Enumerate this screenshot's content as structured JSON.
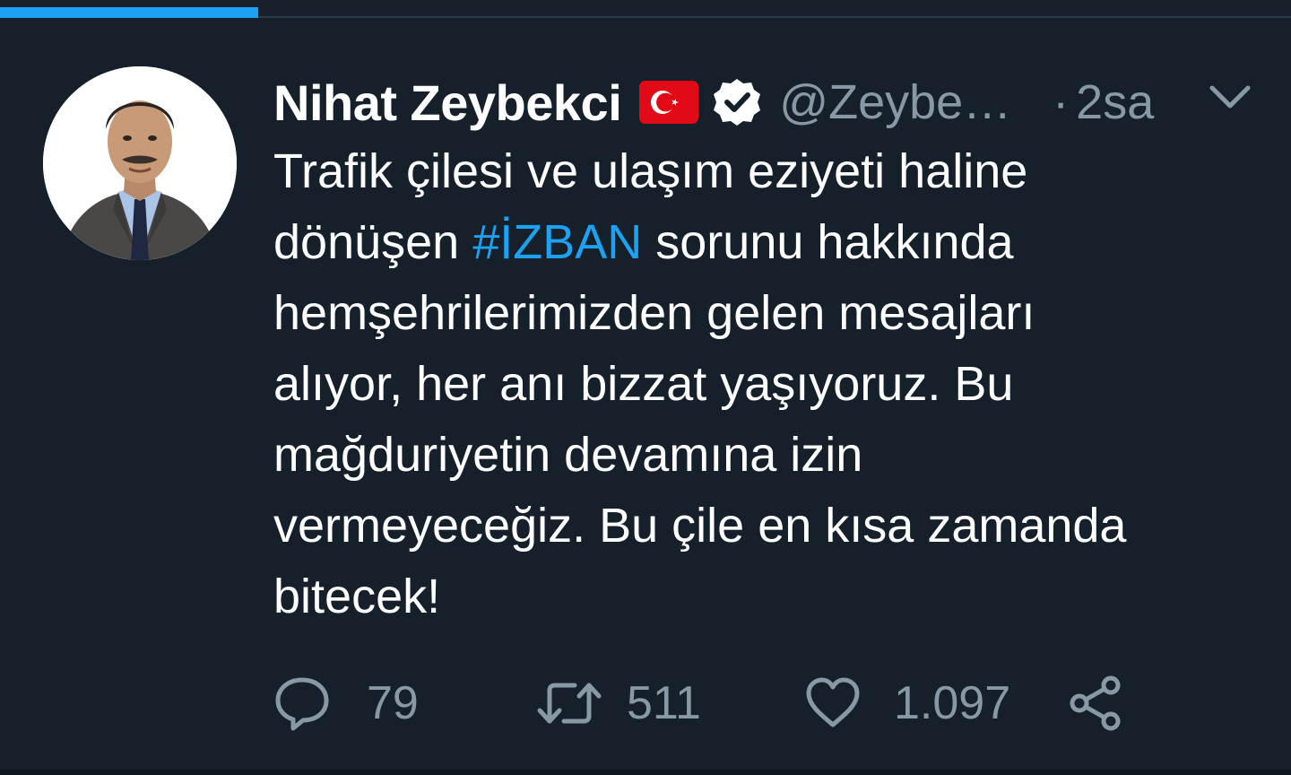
{
  "progress": {
    "value": 0.2
  },
  "tweet": {
    "author_name": "Nihat Zeybekci",
    "handle": "@Zeybe…",
    "separator": "·",
    "time": "2sa",
    "flag_icon": "turkey-flag-icon",
    "verified_icon": "verified-badge-icon",
    "menu_icon": "chevron-down-icon",
    "text_before": "Trafik çilesi ve ulaşım eziyeti haline\ndönüşen ",
    "hashtag": "#İZBAN",
    "text_after": " sorunu hakkında\nhemşehrilerimizden gelen mesajları\nalıyor, her anı bizzat yaşıyoruz. Bu\nmağduriyetin devamına izin\nvermeyeceğiz. Bu çile en kısa zamanda\nbitecek!"
  },
  "actions": {
    "reply": {
      "icon": "reply-icon",
      "count": "79"
    },
    "retweet": {
      "icon": "retweet-icon",
      "count": "511"
    },
    "like": {
      "icon": "heart-icon",
      "count": "1.097"
    },
    "share": {
      "icon": "share-icon"
    }
  },
  "colors": {
    "background": "#15202b",
    "accent": "#1da1f2",
    "secondary_text": "#8899a6",
    "flag_red": "#e30a17"
  }
}
